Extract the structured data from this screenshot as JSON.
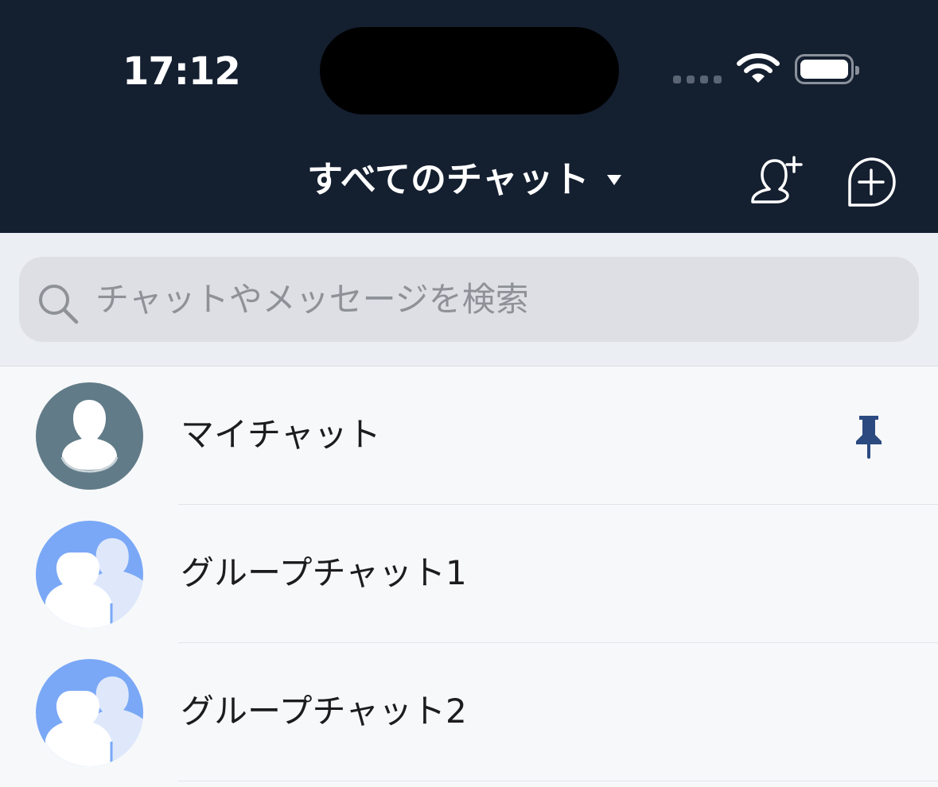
{
  "status_bar": {
    "time": "17:12"
  },
  "header": {
    "title": "すべてのチャット",
    "dropdown_icon": "caret-down-icon",
    "actions": [
      {
        "name": "add-friend",
        "icon": "person-plus-icon"
      },
      {
        "name": "new-chat",
        "icon": "chat-bubble-plus-icon"
      }
    ]
  },
  "search": {
    "placeholder": "チャットやメッセージを検索",
    "icon": "search-icon"
  },
  "chats": [
    {
      "name": "マイチャット",
      "avatar": "single-person-avatar",
      "pinned": true
    },
    {
      "name": "グループチャット1",
      "avatar": "group-avatar",
      "pinned": false
    },
    {
      "name": "グループチャット2",
      "avatar": "group-avatar",
      "pinned": false
    }
  ],
  "colors": {
    "header_bg": "#141f30",
    "pin": "#2b4a80",
    "group_avatar": "#7aa8f7",
    "single_avatar": "#617b88"
  }
}
